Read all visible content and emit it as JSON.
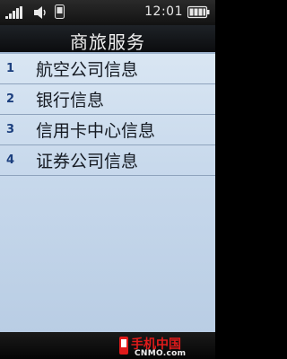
{
  "status_bar": {
    "signal_icon": "signal-bars-icon",
    "sound_icon": "speaker-icon",
    "memory_icon": "memory-card-icon",
    "time": "12:01",
    "battery_icon": "battery-icon"
  },
  "header": {
    "title": "商旅服务"
  },
  "menu": {
    "items": [
      {
        "number": "1",
        "label": "航空公司信息"
      },
      {
        "number": "2",
        "label": "银行信息"
      },
      {
        "number": "3",
        "label": "信用卡中心信息"
      },
      {
        "number": "4",
        "label": "证券公司信息"
      }
    ]
  },
  "watermark": {
    "cn": "手机中国",
    "en": "CNMO.com",
    "icon": "phone-logo-icon"
  },
  "colors": {
    "title_bar": "#0b0c0e",
    "list_bg": "#c8d9ec",
    "number": "#1c3f7e",
    "watermark_red": "#e01b1b"
  }
}
